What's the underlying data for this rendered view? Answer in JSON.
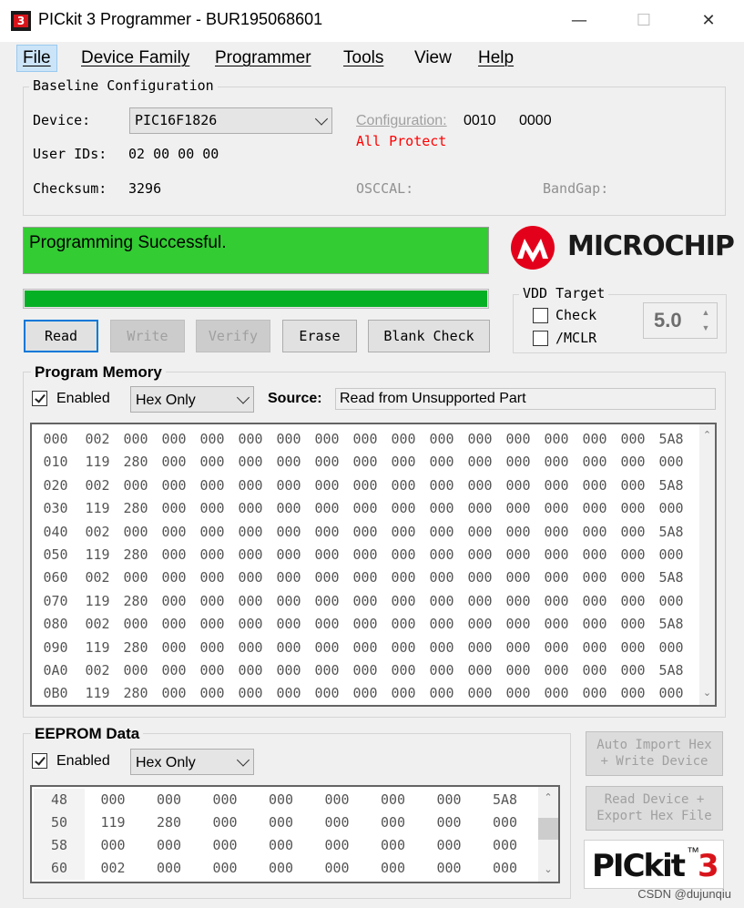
{
  "window": {
    "title": "PICkit 3 Programmer - BUR195068601",
    "minimize_icon": "minimize-icon",
    "maximize_icon": "maximize-icon",
    "close_icon": "close-icon"
  },
  "menu": [
    "File",
    "Device Family",
    "Programmer",
    "Tools",
    "View",
    "Help"
  ],
  "config": {
    "group_title": "Baseline Configuration",
    "device_label": "Device:",
    "device_value": "PIC16F1826",
    "user_ids_label": "User IDs:",
    "user_ids_value": "02 00 00 00",
    "checksum_label": "Checksum:",
    "checksum_value": "3296",
    "configuration_label": "Configuration:",
    "config_word1": "0010",
    "config_word2": "0000",
    "all_protect": "All Protect",
    "osccal_label": "OSCCAL:",
    "bandgap_label": "BandGap:"
  },
  "status": {
    "message": "Programming Successful.",
    "progress": 1.0,
    "color": "#33cc33",
    "progress_color": "#06b025"
  },
  "logo": {
    "text": "MICROCHIP",
    "icon": "microchip-logo-icon",
    "color": "#e3001b"
  },
  "buttons": {
    "read": "Read",
    "write": "Write",
    "verify": "Verify",
    "erase": "Erase",
    "blank_check": "Blank Check"
  },
  "vdd": {
    "title": "VDD Target",
    "check_label": "Check",
    "mclr_label": "/MCLR",
    "voltage": "5.0"
  },
  "program_memory": {
    "title": "Program Memory",
    "enabled_label": "Enabled",
    "mode": "Hex Only",
    "source_label": "Source:",
    "source_value": "Read from Unsupported Part",
    "rows": [
      {
        "addr": "000",
        "cells": [
          "002",
          "000",
          "000",
          "000",
          "000",
          "000",
          "000",
          "000",
          "000",
          "000",
          "000",
          "000",
          "000",
          "000",
          "000",
          "5A8"
        ]
      },
      {
        "addr": "010",
        "cells": [
          "119",
          "280",
          "000",
          "000",
          "000",
          "000",
          "000",
          "000",
          "000",
          "000",
          "000",
          "000",
          "000",
          "000",
          "000",
          "000"
        ]
      },
      {
        "addr": "020",
        "cells": [
          "002",
          "000",
          "000",
          "000",
          "000",
          "000",
          "000",
          "000",
          "000",
          "000",
          "000",
          "000",
          "000",
          "000",
          "000",
          "5A8"
        ]
      },
      {
        "addr": "030",
        "cells": [
          "119",
          "280",
          "000",
          "000",
          "000",
          "000",
          "000",
          "000",
          "000",
          "000",
          "000",
          "000",
          "000",
          "000",
          "000",
          "000"
        ]
      },
      {
        "addr": "040",
        "cells": [
          "002",
          "000",
          "000",
          "000",
          "000",
          "000",
          "000",
          "000",
          "000",
          "000",
          "000",
          "000",
          "000",
          "000",
          "000",
          "5A8"
        ]
      },
      {
        "addr": "050",
        "cells": [
          "119",
          "280",
          "000",
          "000",
          "000",
          "000",
          "000",
          "000",
          "000",
          "000",
          "000",
          "000",
          "000",
          "000",
          "000",
          "000"
        ]
      },
      {
        "addr": "060",
        "cells": [
          "002",
          "000",
          "000",
          "000",
          "000",
          "000",
          "000",
          "000",
          "000",
          "000",
          "000",
          "000",
          "000",
          "000",
          "000",
          "5A8"
        ]
      },
      {
        "addr": "070",
        "cells": [
          "119",
          "280",
          "000",
          "000",
          "000",
          "000",
          "000",
          "000",
          "000",
          "000",
          "000",
          "000",
          "000",
          "000",
          "000",
          "000"
        ]
      },
      {
        "addr": "080",
        "cells": [
          "002",
          "000",
          "000",
          "000",
          "000",
          "000",
          "000",
          "000",
          "000",
          "000",
          "000",
          "000",
          "000",
          "000",
          "000",
          "5A8"
        ]
      },
      {
        "addr": "090",
        "cells": [
          "119",
          "280",
          "000",
          "000",
          "000",
          "000",
          "000",
          "000",
          "000",
          "000",
          "000",
          "000",
          "000",
          "000",
          "000",
          "000"
        ]
      },
      {
        "addr": "0A0",
        "cells": [
          "002",
          "000",
          "000",
          "000",
          "000",
          "000",
          "000",
          "000",
          "000",
          "000",
          "000",
          "000",
          "000",
          "000",
          "000",
          "5A8"
        ]
      },
      {
        "addr": "0B0",
        "cells": [
          "119",
          "280",
          "000",
          "000",
          "000",
          "000",
          "000",
          "000",
          "000",
          "000",
          "000",
          "000",
          "000",
          "000",
          "000",
          "000"
        ]
      }
    ]
  },
  "eeprom": {
    "title": "EEPROM Data",
    "enabled_label": "Enabled",
    "mode": "Hex Only",
    "rows": [
      {
        "addr": "48",
        "cells": [
          "000",
          "000",
          "000",
          "000",
          "000",
          "000",
          "000",
          "5A8"
        ]
      },
      {
        "addr": "50",
        "cells": [
          "119",
          "280",
          "000",
          "000",
          "000",
          "000",
          "000",
          "000"
        ]
      },
      {
        "addr": "58",
        "cells": [
          "000",
          "000",
          "000",
          "000",
          "000",
          "000",
          "000",
          "000"
        ]
      },
      {
        "addr": "60",
        "cells": [
          "002",
          "000",
          "000",
          "000",
          "000",
          "000",
          "000",
          "000"
        ]
      }
    ]
  },
  "side_buttons": {
    "auto_import_line1": "Auto Import Hex",
    "auto_import_line2": "+ Write Device",
    "read_export_line1": "Read Device +",
    "read_export_line2": "Export Hex File"
  },
  "pickit_logo": {
    "text": "PICkit",
    "tm": "™",
    "num": "3"
  },
  "watermark": "CSDN @dujunqiu"
}
